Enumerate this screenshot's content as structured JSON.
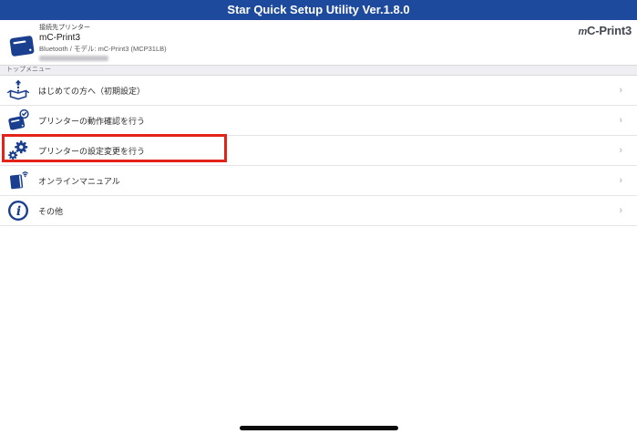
{
  "app_header": {
    "title": "Star Quick Setup Utility Ver.1.8.0"
  },
  "printer_panel": {
    "section_label": "接続先プリンター",
    "printer_name": "mC-Print3",
    "connection_info": "Bluetooth / モデル: mC-Print3 (MCP31LB)",
    "address_redacted": true,
    "brand_logo": "mC-Print3",
    "printer_icon": "printer-cube-icon"
  },
  "menu": {
    "section_title": "トップメニュー",
    "chevron_glyph": "›",
    "items": [
      {
        "label": "はじめての方へ（初期設定）",
        "icon": "unbox-arrow-icon",
        "highlighted": false
      },
      {
        "label": "プリンターの動作確認を行う",
        "icon": "printer-check-icon",
        "highlighted": false
      },
      {
        "label": "プリンターの設定変更を行う",
        "icon": "gears-icon",
        "highlighted": true
      },
      {
        "label": "オンラインマニュアル",
        "icon": "book-wifi-icon",
        "highlighted": false
      },
      {
        "label": "その他",
        "icon": "info-icon",
        "highlighted": false
      }
    ]
  },
  "colors": {
    "header_blue": "#1e4a9e",
    "icon_blue": "#1b3f8f",
    "highlight_red": "#e3221a",
    "band_gray": "#eeeef3"
  }
}
